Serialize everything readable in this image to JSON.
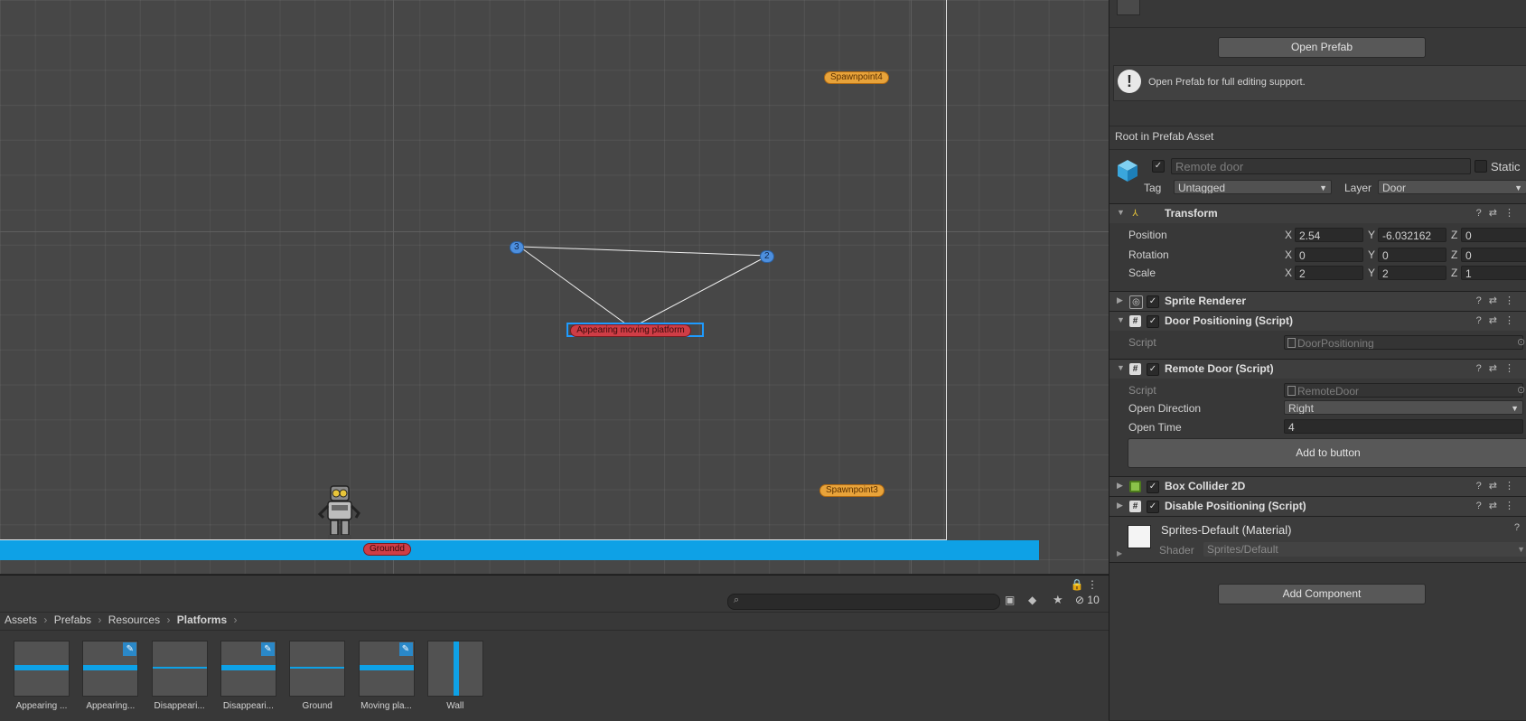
{
  "scene": {
    "labels": {
      "spawn4": "Spawnpoint4",
      "spawn3": "Spawnpoint3",
      "point3": "3",
      "point2": "2",
      "platform": "Appearing moving platform",
      "ground": "Groundd"
    }
  },
  "inspector": {
    "open_prefab": "Open Prefab",
    "info_text": "Open Prefab for full editing support.",
    "root_label": "Root in Prefab Asset",
    "object_name": "Remote door",
    "static_label": "Static",
    "tag_label": "Tag",
    "tag_value": "Untagged",
    "layer_label": "Layer",
    "layer_value": "Door",
    "transform": {
      "title": "Transform",
      "position_label": "Position",
      "rotation_label": "Rotation",
      "scale_label": "Scale",
      "position": {
        "x": "2.54",
        "y": "-6.032162",
        "z": "0"
      },
      "rotation": {
        "x": "0",
        "y": "0",
        "z": "0"
      },
      "scale": {
        "x": "2",
        "y": "2",
        "z": "1"
      },
      "axis": {
        "x": "X",
        "y": "Y",
        "z": "Z"
      }
    },
    "sprite_renderer": "Sprite Renderer",
    "door_positioning": {
      "title": "Door Positioning (Script)",
      "script_label": "Script",
      "script_value": "DoorPositioning"
    },
    "remote_door": {
      "title": "Remote Door (Script)",
      "script_label": "Script",
      "script_value": "RemoteDoor",
      "open_direction_label": "Open Direction",
      "open_direction_value": "Right",
      "open_time_label": "Open Time",
      "open_time_value": "4",
      "add_to_button": "Add to button"
    },
    "box_collider": "Box Collider 2D",
    "disable_positioning": "Disable Positioning (Script)",
    "material": {
      "title": "Sprites-Default (Material)",
      "shader_label": "Shader",
      "shader_value": "Sprites/Default"
    },
    "add_component": "Add Component"
  },
  "project": {
    "breadcrumb": [
      "Assets",
      "Prefabs",
      "Resources",
      "Platforms"
    ],
    "hidden_count": "10",
    "assets": [
      {
        "name": "Appearing ...",
        "kind": "bar",
        "edit": false
      },
      {
        "name": "Appearing...",
        "kind": "bar",
        "edit": true
      },
      {
        "name": "Disappeari...",
        "kind": "thin",
        "edit": false
      },
      {
        "name": "Disappeari...",
        "kind": "bar",
        "edit": true
      },
      {
        "name": "Ground",
        "kind": "thin",
        "edit": false
      },
      {
        "name": "Moving pla...",
        "kind": "bar",
        "edit": true
      },
      {
        "name": "Wall",
        "kind": "vertical",
        "edit": false
      }
    ]
  }
}
